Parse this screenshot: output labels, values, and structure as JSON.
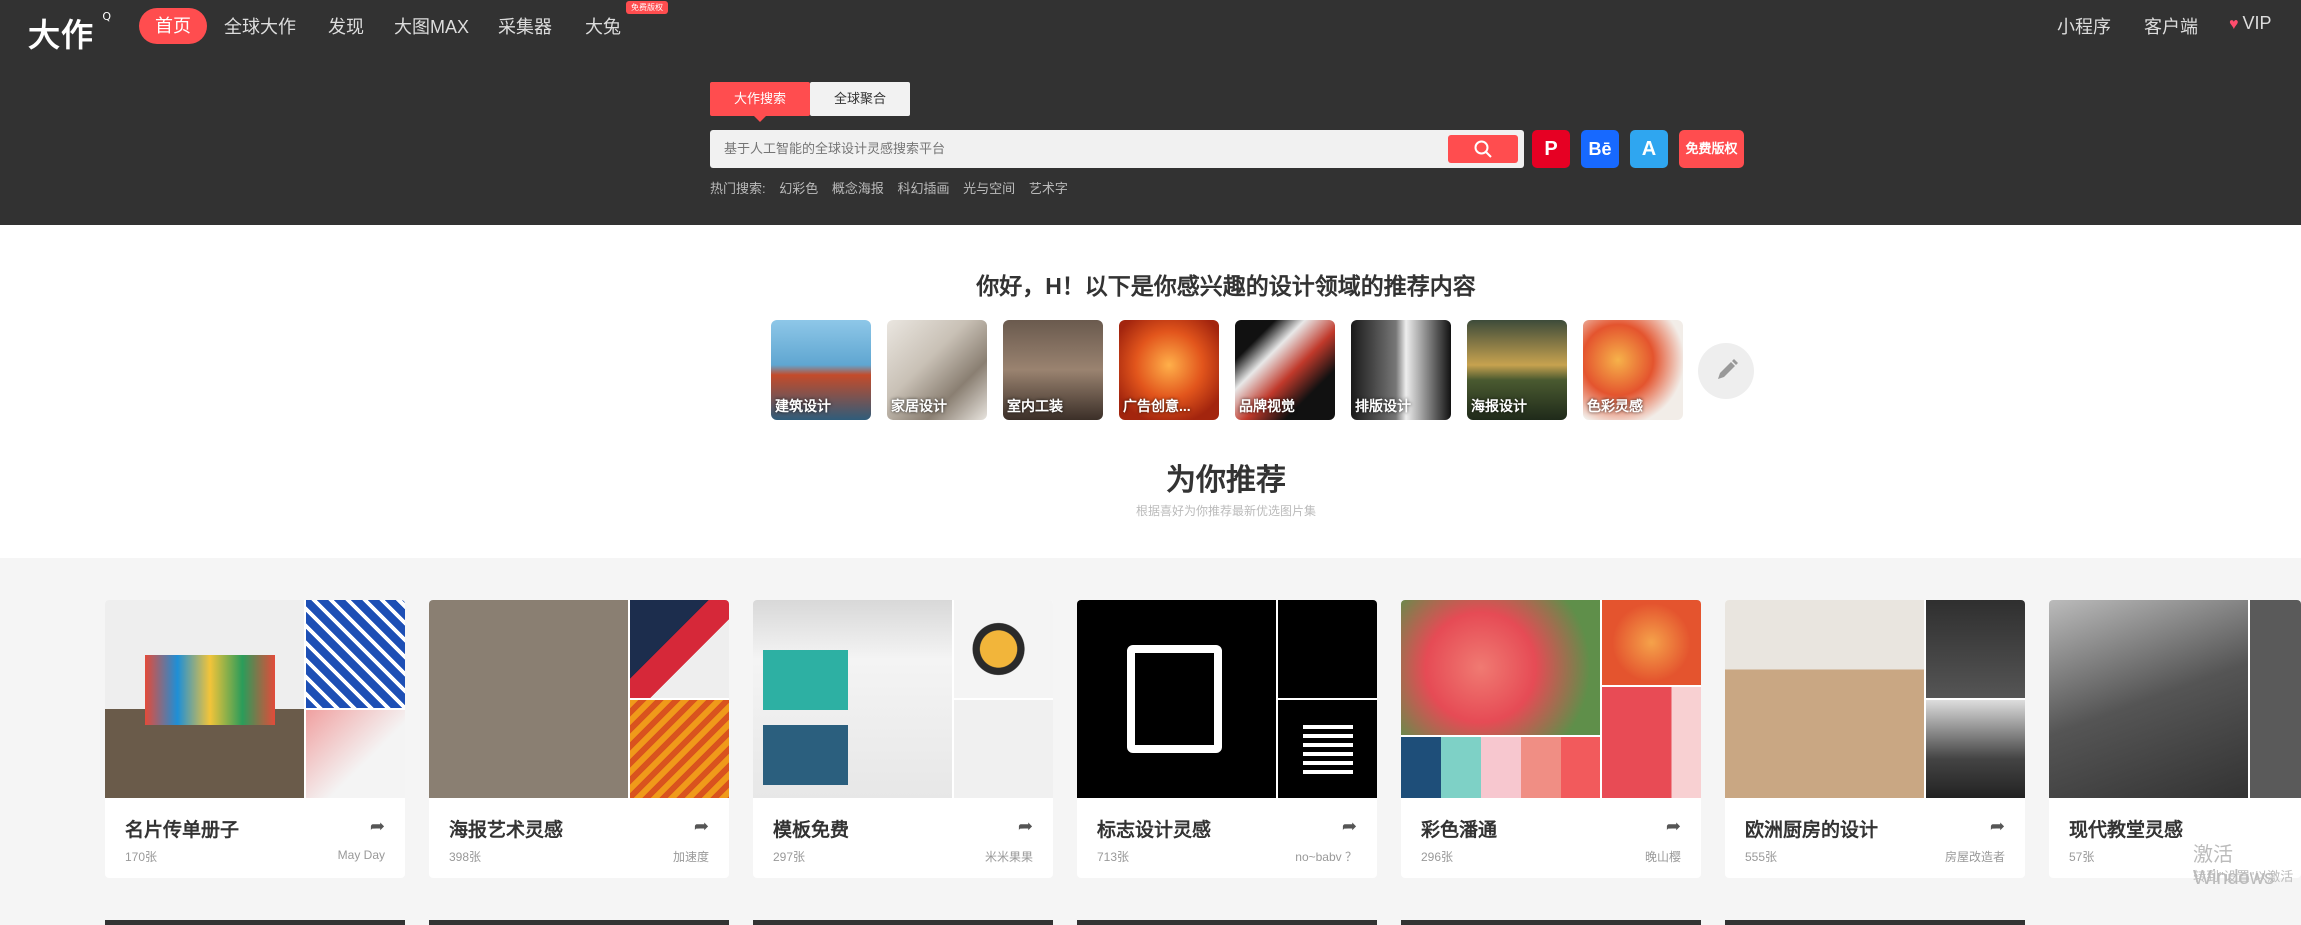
{
  "nav": {
    "logo": "大作",
    "logo_small": "Q",
    "items": [
      {
        "label": "首页"
      },
      {
        "label": "全球大作"
      },
      {
        "label": "发现"
      },
      {
        "label": "大图MAX"
      },
      {
        "label": "采集器"
      },
      {
        "label": "大兔"
      }
    ],
    "badge": "免费版权",
    "right": [
      {
        "label": "小程序"
      },
      {
        "label": "客户端"
      },
      {
        "label": "VIP"
      }
    ]
  },
  "search": {
    "tabs": [
      "大作搜索",
      "全球聚合"
    ],
    "placeholder": "基于人工智能的全球设计灵感搜索平台",
    "ext": {
      "pinterest": "P",
      "behance": "Bē",
      "adobe": "A",
      "free": "免费版权"
    },
    "hot_label": "热门搜索:",
    "hot": [
      "幻彩色",
      "概念海报",
      "科幻插画",
      "光与空间",
      "艺术字"
    ]
  },
  "greeting": "你好，H！以下是你感兴趣的设计领域的推荐内容",
  "categories": [
    {
      "label": "建筑设计"
    },
    {
      "label": "家居设计"
    },
    {
      "label": "室内工装"
    },
    {
      "label": "广告创意..."
    },
    {
      "label": "品牌视觉"
    },
    {
      "label": "排版设计"
    },
    {
      "label": "海报设计"
    },
    {
      "label": "色彩灵感"
    }
  ],
  "recommend": {
    "title": "为你推荐",
    "subtitle": "根据喜好为你推荐最新优选图片集"
  },
  "cards": [
    {
      "title": "名片传单册子",
      "count": "170张",
      "author": "May Day"
    },
    {
      "title": "海报艺术灵感",
      "count": "398张",
      "author": "加速度"
    },
    {
      "title": "模板免费",
      "count": "297张",
      "author": "米米果果"
    },
    {
      "title": "标志设计灵感",
      "count": "713张",
      "author": "no~babv ？"
    },
    {
      "title": "彩色潘通",
      "count": "296张",
      "author": "晚山樱"
    },
    {
      "title": "欧洲厨房的设计",
      "count": "555张",
      "author": "房屋改造者"
    },
    {
      "title": "现代教堂灵感",
      "count": "57张",
      "author": ""
    }
  ],
  "watermark": {
    "line1": "激活 Windows",
    "line2": "转到\"设置\"以激活"
  },
  "colors": {
    "accent": "#ff4d4f",
    "dark": "#323232"
  }
}
